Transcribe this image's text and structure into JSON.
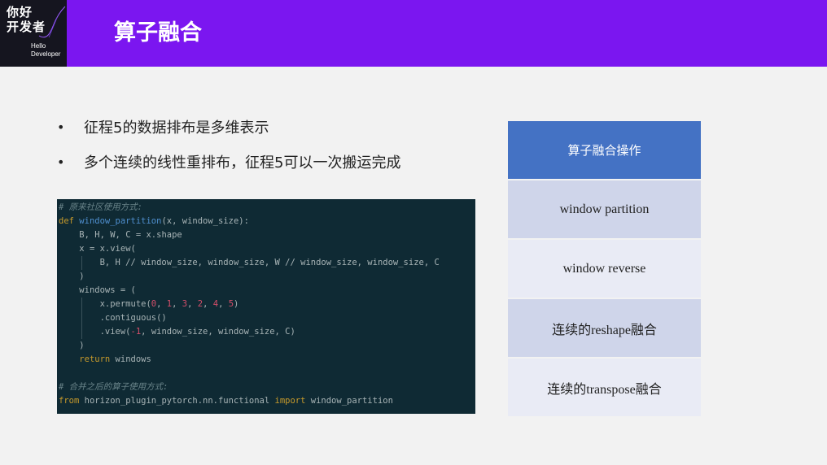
{
  "logo": {
    "title_line1": "你好",
    "title_line2": "开发者",
    "sub_line1": "Hello",
    "sub_line2": "Developer"
  },
  "page_title": "算子融合",
  "bullets": [
    "征程5的数据排布是多维表示",
    "多个连续的线性重排布，征程5可以一次搬运完成"
  ],
  "code": {
    "comment1": "# 原来社区使用方式:",
    "def_kw": "def",
    "func_name": "window_partition",
    "signature": "(x, window_size):",
    "line3": "B, H, W, C = x.shape",
    "line4": "x = x.view(",
    "line5": "B, H // window_size, window_size, W // window_size, window_size, C",
    "line6": ")",
    "line7": "windows = (",
    "permute_pre": "x.permute(",
    "p0": "0",
    "p1": "1",
    "p2": "3",
    "p3": "2",
    "p4": "4",
    "p5": "5",
    "line9": ".contiguous()",
    "view_pre": ".view(",
    "neg1": "-1",
    "view_post": ", window_size, window_size, C)",
    "line11": ")",
    "return_kw": "return",
    "return_val": " windows",
    "comment2": "# 合并之后的算子使用方式:",
    "from_kw": "from",
    "module": " horizon_plugin_pytorch.nn.functional ",
    "import_kw": "import",
    "import_name": " window_partition"
  },
  "table": {
    "header": "算子融合操作",
    "rows": [
      "window partition",
      "window reverse",
      "连续的reshape融合",
      "连续的transpose融合"
    ]
  },
  "colors": {
    "header_bar": "#7b16f0",
    "table_header": "#4472c4",
    "row_dark": "#cfd5ea",
    "row_light": "#e9ebf5",
    "code_bg": "#0f2a34"
  }
}
